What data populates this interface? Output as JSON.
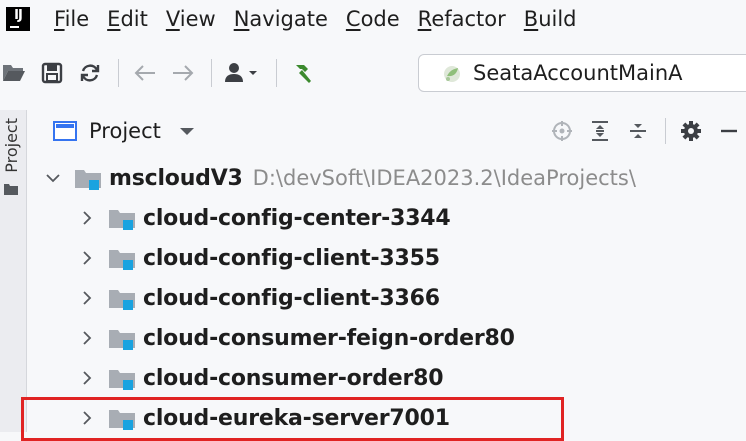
{
  "app": {
    "logo_text": "IJ",
    "brand_color": "#000000"
  },
  "menu": {
    "items": [
      {
        "mn": "F",
        "rest": "ile"
      },
      {
        "mn": "E",
        "rest": "dit"
      },
      {
        "mn": "V",
        "rest": "iew"
      },
      {
        "mn": "N",
        "rest": "avigate"
      },
      {
        "mn": "C",
        "rest": "ode"
      },
      {
        "mn": "R",
        "rest": "efactor"
      },
      {
        "mn": "B",
        "rest": "uild"
      }
    ]
  },
  "toolbar": {
    "icons": [
      "open-folder-icon",
      "save-icon",
      "sync-icon",
      "back-arrow-icon",
      "forward-arrow-icon",
      "user-dropdown-icon",
      "build-hammer-icon"
    ],
    "run_config": "SeataAccountMainA"
  },
  "side_tab": {
    "label": "Project"
  },
  "project_panel": {
    "title": "Project",
    "header_icons": [
      "locate-icon",
      "expand-all-icon",
      "collapse-all-icon",
      "gear-icon",
      "hide-icon"
    ]
  },
  "tree": {
    "root": {
      "name": "mscloudV3",
      "path": "D:\\devSoft\\IDEA2023.2\\IdeaProjects\\"
    },
    "children": [
      {
        "name": "cloud-config-center-3344"
      },
      {
        "name": "cloud-config-client-3355"
      },
      {
        "name": "cloud-config-client-3366"
      },
      {
        "name": "cloud-consumer-feign-order80"
      },
      {
        "name": "cloud-consumer-order80"
      },
      {
        "name": "cloud-eureka-server7001"
      }
    ]
  },
  "colors": {
    "folder": "#a8adb4",
    "module_marker": "#1aa3e0",
    "highlight": "#e02323",
    "build_green": "#3c8a2e"
  }
}
